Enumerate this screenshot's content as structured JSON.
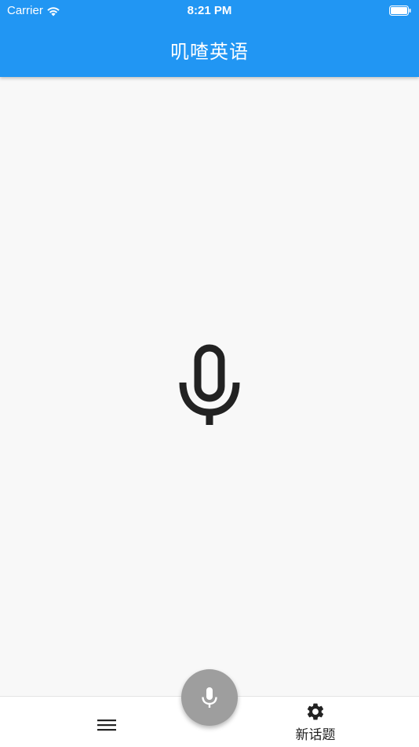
{
  "status_bar": {
    "carrier": "Carrier",
    "time": "8:21 PM"
  },
  "app_bar": {
    "title": "叽喳英语",
    "background_color": "#2196f3"
  },
  "center": {
    "icon": "microphone-icon"
  },
  "bottom_bar": {
    "menu_icon": "hamburger-menu-icon",
    "new_topic_icon": "gear-icon",
    "new_topic_label": "新话题"
  },
  "fab": {
    "icon": "microphone-icon",
    "color": "#9e9e9e"
  }
}
